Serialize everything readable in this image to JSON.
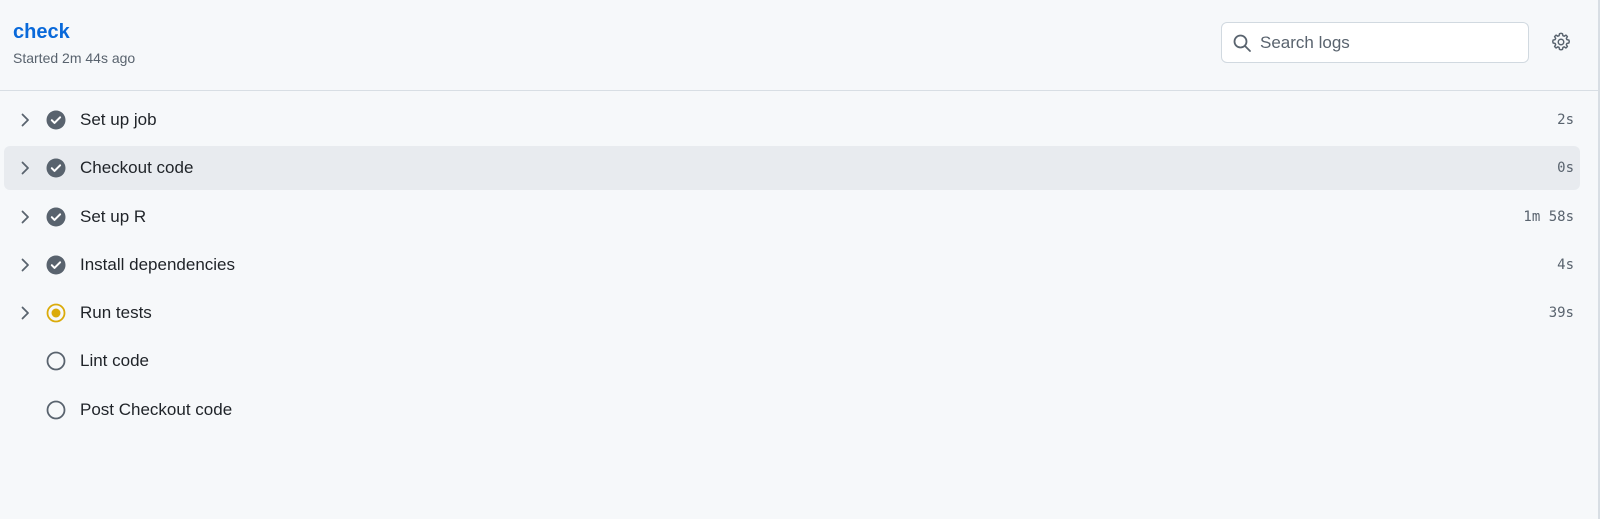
{
  "job": {
    "title": "check",
    "subtitle": "Started 2m 44s ago"
  },
  "search": {
    "placeholder": "Search logs",
    "value": ""
  },
  "icons": {
    "search": "search-icon",
    "settings": "gear-icon",
    "expand": "chevron-right-icon",
    "success": "check-circle-fill-icon",
    "in_progress": "dot-fill-icon",
    "queued": "circle-icon"
  },
  "colors": {
    "title": "#0969da",
    "success_status": "#59636e",
    "in_progress_status": "#dbab0a",
    "queued_status": "#59636e"
  },
  "steps": [
    {
      "name": "Set up job",
      "duration": "2s",
      "status": "success",
      "expandable": true
    },
    {
      "name": "Checkout code",
      "duration": "0s",
      "status": "success",
      "expandable": true
    },
    {
      "name": "Set up R",
      "duration": "1m 58s",
      "status": "success",
      "expandable": true
    },
    {
      "name": "Install dependencies",
      "duration": "4s",
      "status": "success",
      "expandable": true
    },
    {
      "name": "Run tests",
      "duration": "39s",
      "status": "in_progress",
      "expandable": true
    },
    {
      "name": "Lint code",
      "duration": "",
      "status": "queued",
      "expandable": false
    },
    {
      "name": "Post Checkout code",
      "duration": "",
      "status": "queued",
      "expandable": false
    }
  ]
}
